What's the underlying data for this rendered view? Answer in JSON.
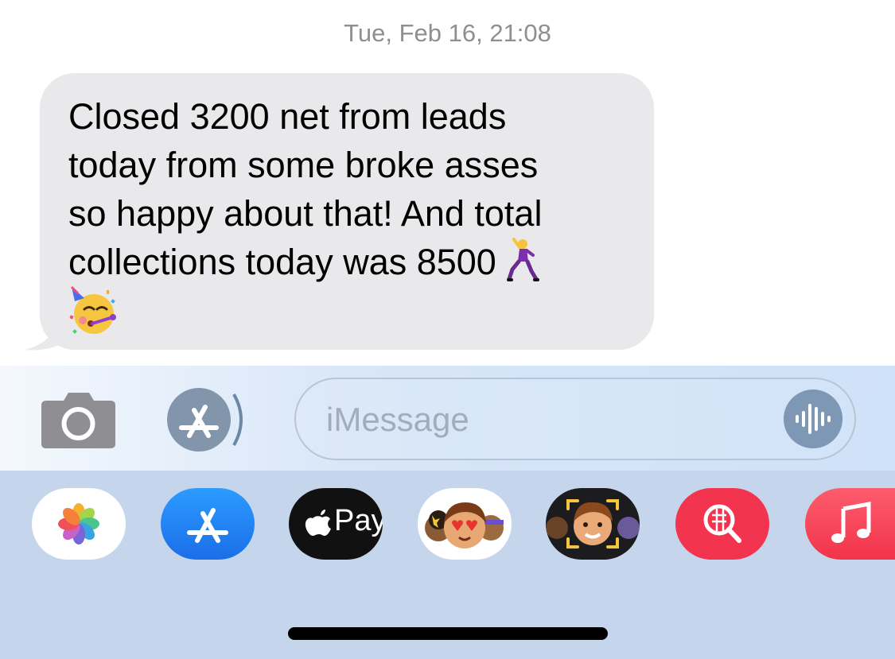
{
  "conversation": {
    "timestamp": "Tue, Feb 16, 21:08",
    "message": {
      "text": "Closed 3200 net from leads\ntoday from some broke asses\nso happy about that! And total\ncollections today was 8500 ",
      "emojis": [
        "man-dancing-emoji",
        "partying-face-emoji"
      ]
    }
  },
  "compose": {
    "placeholder": "iMessage",
    "icons": [
      "camera-icon",
      "app-store-icon",
      "audio-waveform-icon"
    ]
  },
  "app_drawer": {
    "apps": [
      {
        "name": "Photos",
        "icon": "photos-icon"
      },
      {
        "name": "App Store",
        "icon": "app-store-icon"
      },
      {
        "name": "Apple Pay",
        "icon": "apple-pay-icon",
        "label": "Pay"
      },
      {
        "name": "Memoji Stickers",
        "icon": "memoji-stickers-icon"
      },
      {
        "name": "Memoji",
        "icon": "memoji-icon"
      },
      {
        "name": "Search Images",
        "icon": "search-images-icon"
      },
      {
        "name": "Music",
        "icon": "music-icon"
      }
    ]
  },
  "colors": {
    "bubble": "#e9e9eb",
    "drawer": "#c5d6ec",
    "timestamp": "#8e8e93",
    "app_store_blue": "#1a84ff",
    "search_red": "#f2344f",
    "music_red": "#fb3a4f"
  }
}
